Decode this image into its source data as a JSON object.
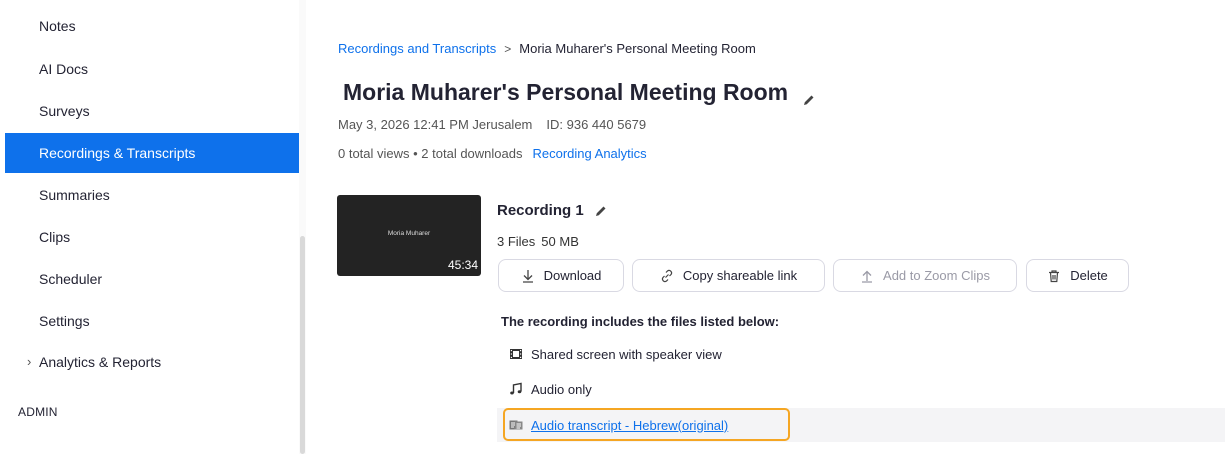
{
  "sidebar": {
    "items": [
      {
        "label": "Notes"
      },
      {
        "label": "AI Docs"
      },
      {
        "label": "Surveys"
      },
      {
        "label": "Recordings & Transcripts"
      },
      {
        "label": "Summaries"
      },
      {
        "label": "Clips"
      },
      {
        "label": "Scheduler"
      },
      {
        "label": "Settings"
      },
      {
        "label": "Analytics & Reports"
      }
    ],
    "section_label": "ADMIN",
    "active_color": "#0e71eb"
  },
  "breadcrumb": {
    "parent": "Recordings and Transcripts",
    "separator": ">",
    "current": "Moria Muharer's Personal Meeting Room"
  },
  "meeting": {
    "title": "Moria Muharer's Personal Meeting Room",
    "datetime": "May 3, 2026 12:41 PM Jerusalem",
    "id_text": "ID: 936 440 5679",
    "stats": "0 total views • 2 total downloads",
    "analytics_link": "Recording Analytics"
  },
  "recording": {
    "thumbnail_name": "Moria Muharer",
    "duration": "45:34",
    "title": "Recording 1",
    "file_count": "3 Files",
    "size": "50 MB",
    "buttons": {
      "download": "Download",
      "copy_link": "Copy shareable link",
      "add_clips": "Add to Zoom Clips",
      "delete": "Delete"
    },
    "files_heading": "The recording includes the files listed below:",
    "files": [
      {
        "label": "Shared screen with speaker view",
        "icon": "video-file-icon"
      },
      {
        "label": "Audio only",
        "icon": "music-note-icon"
      },
      {
        "label": "Audio transcript - Hebrew(original)",
        "icon": "transcript-icon"
      }
    ]
  },
  "colors": {
    "accent": "#0e71eb",
    "focus": "#f5a623"
  }
}
